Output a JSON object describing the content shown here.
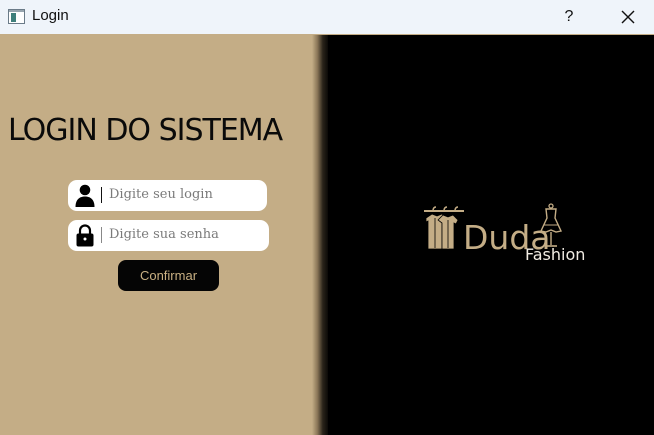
{
  "window": {
    "title": "Login",
    "help_label": "?",
    "icons": {
      "app": "window-app-icon",
      "close": "close-icon"
    }
  },
  "login_form": {
    "heading": "LOGIN DO SISTEMA",
    "login_field": {
      "placeholder": "Digite seu login",
      "value": "",
      "icon": "user-icon"
    },
    "password_field": {
      "placeholder": "Digite sua senha",
      "value": "",
      "icon": "lock-icon"
    },
    "confirm_label": "Confirmar"
  },
  "brand": {
    "name": "Duda",
    "subtitle": "Fashion",
    "icons": {
      "clothes": "clothes-hanger-icon",
      "dress": "dress-mannequin-icon"
    }
  },
  "colors": {
    "panel_left": "#c4ad86",
    "panel_right": "#000000",
    "accent": "#c4ad86",
    "button_bg": "#050505",
    "button_text": "#c9b083"
  }
}
